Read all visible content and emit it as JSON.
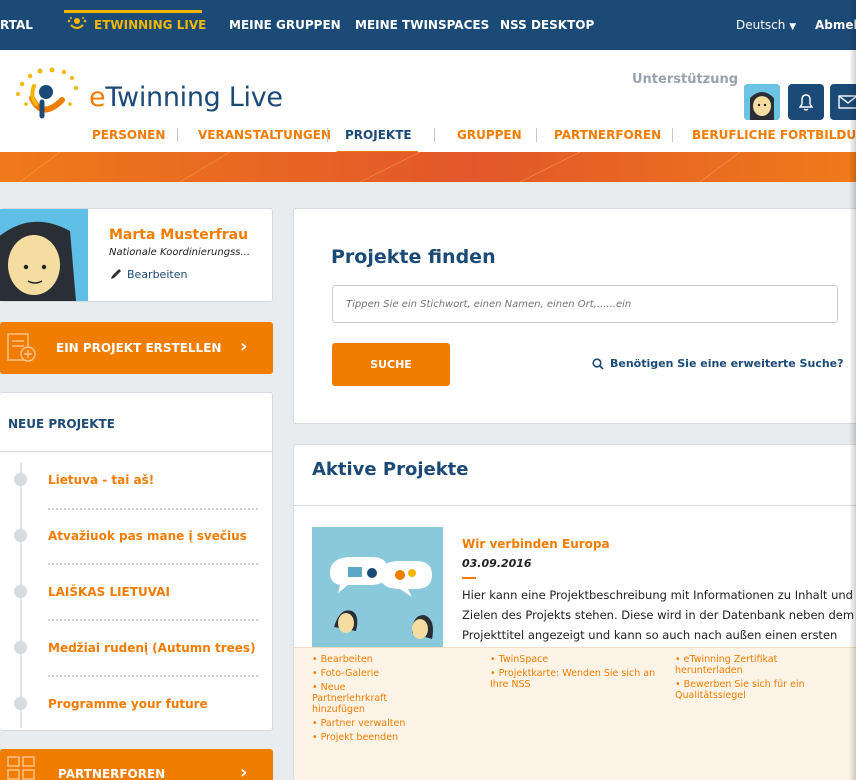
{
  "topbar": {
    "items": [
      "RTAL",
      "ETWINNING LIVE",
      "MEINE GRUPPEN",
      "MEINE TWINSPACES",
      "NSS DESKTOP"
    ],
    "language": "Deutsch",
    "logout": "Abmelc"
  },
  "header": {
    "logo_e": "e",
    "logo_rest": "Twinning Live",
    "support": "Unterstützung",
    "nav": [
      "PERSONEN",
      "VERANSTALTUNGEN",
      "PROJEKTE",
      "GRUPPEN",
      "PARTNERFOREN",
      "BERUFLICHE FORTBILDUNG"
    ]
  },
  "profile": {
    "name": "Marta Musterfrau",
    "role": "Nationale Koordinierungss...",
    "edit": "Bearbeiten"
  },
  "create_button": "EIN PROJEKT ERSTELLEN",
  "new_projects": {
    "title": "NEUE PROJEKTE",
    "items": [
      "Lietuva - tai aš!",
      "Atvažiuok pas mane į svečius",
      "LAIŠKAS LIETUVAI",
      "Medžiai rudenį (Autumn trees)",
      "Programme your future"
    ]
  },
  "partner_button": "PARTNERFOREN",
  "finder": {
    "title": "Projekte finden",
    "placeholder": "Tippen Sie ein Stichwort, einen Namen, einen Ort,......ein",
    "button": "SUCHE",
    "advanced": "Benötigen Sie eine erweiterte Suche?"
  },
  "active_projects": {
    "title": "Aktive Projekte",
    "project": {
      "title": "Wir verbinden Europa",
      "date": "03.09.2016",
      "description": "Hier kann eine Projektbeschreibung mit Informationen zu Inhalt und Zielen des Projekts stehen. Diese wird in der Datenbank neben dem Projekttitel angezeigt und kann so auch nach außen einen ersten Eindruck des Projekts vermitteln."
    },
    "links_col1": [
      "• Bearbeiten",
      "• Foto-Galerie",
      "• Neue Partnerlehrkraft hinzufügen",
      "• Partner verwalten",
      "• Projekt beenden"
    ],
    "links_col2": [
      "• TwinSpace",
      "• Projektkarte: Wenden Sie sich an Ihre NSS"
    ],
    "links_col3": [
      "• eTwinning Zertifikat herunterladen",
      "• Bewerben Sie sich für ein Qualitätssiegel"
    ]
  },
  "colors": {
    "navy": "#1b4a77",
    "orange": "#f07c00",
    "yellow": "#f2b705"
  }
}
